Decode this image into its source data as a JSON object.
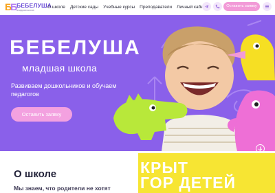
{
  "header": {
    "logo_mark_1": "Б",
    "logo_mark_2": "Б",
    "logo_name": "БЕБЕЛУША",
    "logo_sub": "младшая школа",
    "nav": [
      "О школе",
      "Детские сады",
      "Учебные курсы",
      "Преподаватели",
      "Личный кабинет"
    ],
    "cta": "Оставить заявку"
  },
  "hero": {
    "title": "БЕБЕЛУША",
    "subtitle": "младшая школа",
    "tagline": "Развиваем дошкольников и обучаем педагогов",
    "button": "Оставить заявку"
  },
  "about": {
    "title": "О школе",
    "text": "Мы знаем, что родители не хотят"
  },
  "promo": {
    "text": "КРЫТ\nГОР ДЕТЕЙ"
  },
  "colors": {
    "hero_bg": "#8a60ea",
    "accent_pink": "#f29ad7",
    "accent_yellow": "#f7e533",
    "dino_green": "#b8e83a",
    "duck_yellow": "#f6df23"
  }
}
